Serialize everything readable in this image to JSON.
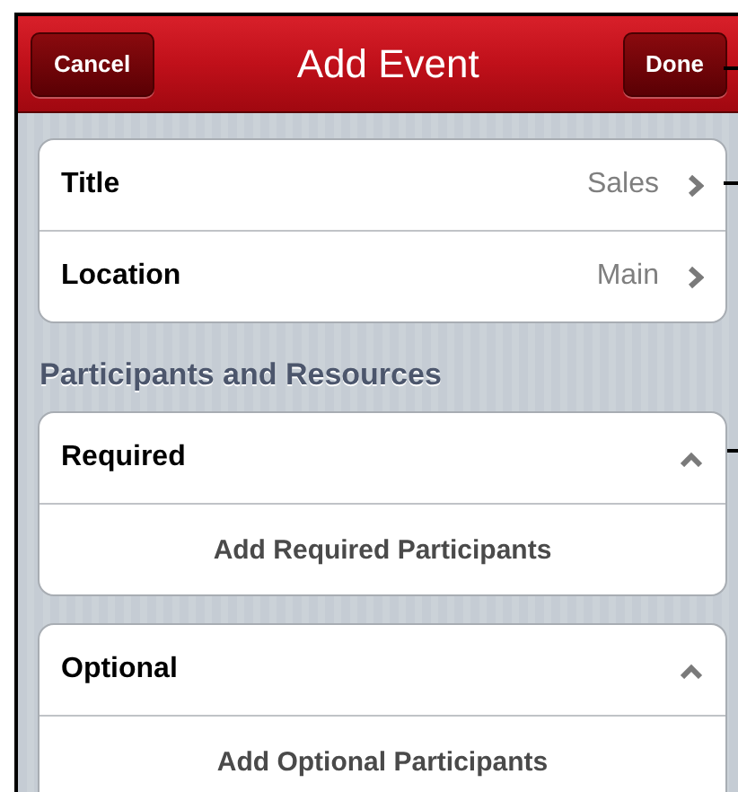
{
  "nav_bar": {
    "cancel_button": "Cancel",
    "title": "Add Event",
    "done_button": "Done"
  },
  "details": [
    {
      "kind": "disclosure",
      "label": "Title",
      "value": "Sales"
    },
    {
      "kind": "disclosure",
      "label": "Location",
      "value": "Main"
    }
  ],
  "section_header": "Participants and Resources",
  "groups": [
    {
      "label": "Required",
      "expanded": true,
      "action": "Add Required Participants"
    },
    {
      "label": "Optional",
      "expanded": true,
      "action": "Add Optional Participants"
    }
  ]
}
